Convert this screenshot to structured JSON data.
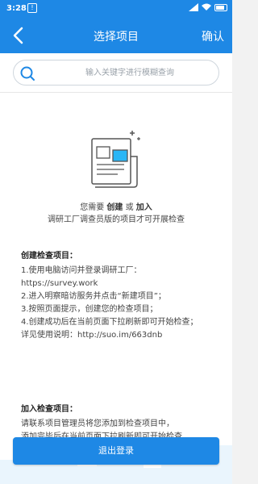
{
  "status_bar": {
    "time": "3:28",
    "alert_icon": "!",
    "battery_icon": "battery-icon"
  },
  "nav": {
    "title": "选择项目",
    "confirm_label": "确认",
    "back_icon": "chevron-left-icon"
  },
  "search": {
    "placeholder": "输入关键字进行模糊查询",
    "icon": "search-icon"
  },
  "empty_state": {
    "line1_prefix": "您需要 ",
    "line1_create": "创建",
    "line1_or": " 或 ",
    "line1_join": "加入",
    "line2": "调研工厂调查员版的项目才可开展检查"
  },
  "create_section": {
    "title": "创建检查项目：",
    "lines": [
      "1.使用电脑访问并登录调研工厂：",
      "https://survey.work",
      "2.进入明察暗访服务并点击“新建项目”；",
      "3.按照页面提示，创建您的检查项目；",
      "4.创建成功后在当前页面下拉刷新即可开始检查；",
      "详见使用说明：http://suo.im/663dnb"
    ]
  },
  "join_section": {
    "title": "加入检查项目：",
    "lines": [
      "请联系项目管理员将您添加到检查项目中，",
      "添加完毕后在当前页面下拉刷新即可开始检查"
    ]
  },
  "logout": {
    "label": "退出登录"
  },
  "colors": {
    "primary": "#1e88e5",
    "illustration_blue": "#29b6f6"
  }
}
